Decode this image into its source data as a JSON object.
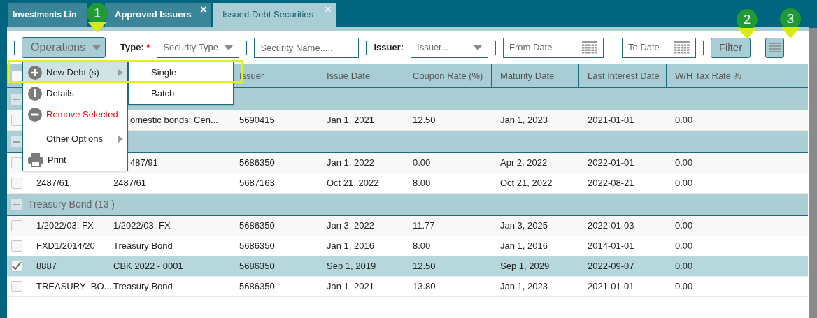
{
  "tabs": [
    {
      "label": "Investments Lin",
      "selected": false,
      "closable": false
    },
    {
      "label": "Approved Issuers",
      "selected": false,
      "closable": true
    },
    {
      "label": "Issued Debt Securities",
      "selected": true,
      "closable": true
    }
  ],
  "close_glyph": "×",
  "callouts": [
    "1",
    "2",
    "3"
  ],
  "toolbar": {
    "operations": "Operations",
    "type_label": "Type:",
    "required_mark": "*",
    "security_type": {
      "placeholder": "Security Type"
    },
    "security_name": {
      "placeholder": "Security Name....."
    },
    "issuer_label": "Issuer:",
    "issuer": {
      "placeholder": "Issuer..."
    },
    "from_date": {
      "placeholder": "From Date"
    },
    "to_date": {
      "placeholder": "To Date"
    },
    "filter": "Filter"
  },
  "operations_menu": {
    "items": [
      {
        "label": "New Debt (s)",
        "highlighted": true,
        "has_submenu": true,
        "danger": false
      },
      {
        "label": "Details",
        "highlighted": false,
        "has_submenu": false,
        "danger": false
      },
      {
        "label": "Remove Selected",
        "highlighted": false,
        "has_submenu": false,
        "danger": true
      },
      {
        "label": "Other Options",
        "highlighted": false,
        "has_submenu": true,
        "danger": false
      },
      {
        "label": "Print",
        "highlighted": false,
        "has_submenu": false,
        "danger": false
      }
    ],
    "submenu": [
      "Single",
      "Batch"
    ]
  },
  "table": {
    "header_checked": false,
    "columns": [
      "Issuer",
      "Issue Date",
      "Coupon Rate (%)",
      "Maturity Date",
      "Last Interest Date",
      "W/H Tax Rate %"
    ],
    "groups": [
      {
        "expanded": true,
        "rows": [
          {
            "checked": false,
            "selected": false,
            "cells": [
              null,
              "omestic bonds: Cen...",
              "5690415",
              "Jan 1, 2021",
              "12.50",
              "Jan 1, 2023",
              "2021-01-01",
              "0.00"
            ]
          }
        ]
      },
      {
        "expanded": true,
        "rows": [
          {
            "checked": false,
            "selected": false,
            "cells": [
              null,
              "487/91",
              "5686350",
              "Jan 1, 2022",
              "0.00",
              "Apr 2, 2022",
              "2022-01-01",
              "0.00"
            ]
          },
          {
            "checked": false,
            "selected": false,
            "cells": [
              "2487/61",
              "2487/61",
              "5687163",
              "Oct 21, 2022",
              "8.00",
              "Oct 21, 2022",
              "2022-08-21",
              "0.00"
            ]
          }
        ]
      },
      {
        "label": "Treasury Bond (13 )",
        "expanded": true,
        "rows": [
          {
            "checked": false,
            "selected": false,
            "cells": [
              "1/2022/03, FX",
              "1/2022/03, FX",
              "5686350",
              "Jan 3, 2022",
              "11.77",
              "Jan 3, 2025",
              "2022-01-03",
              "0.00"
            ]
          },
          {
            "checked": false,
            "selected": false,
            "cells": [
              "FXD1/2014/20",
              "Treasury Bond",
              "5686350",
              "Jan 1, 2016",
              "8.00",
              "Jan 1, 2016",
              "2014-01-01",
              "0.00"
            ]
          },
          {
            "checked": true,
            "selected": true,
            "cells": [
              "8887",
              "CBK 2022 - 0001",
              "5686350",
              "Sep 1, 2019",
              "12.50",
              "Sep 1, 2029",
              "2022-09-07",
              "0.00"
            ]
          },
          {
            "checked": false,
            "selected": false,
            "cells": [
              "TREASURY_BO...",
              "Treasury Bond",
              "5686350",
              "Jan 1, 2021",
              "13.80",
              "Jan 1, 2023",
              "2021-01-01",
              "0.00"
            ]
          }
        ]
      }
    ]
  }
}
